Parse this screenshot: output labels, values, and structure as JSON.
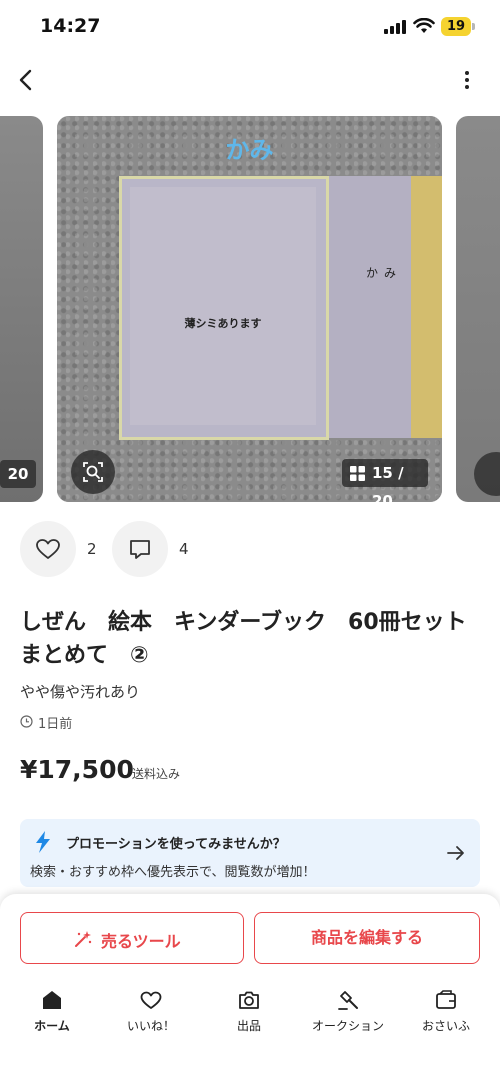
{
  "status_bar": {
    "time": "14:27",
    "battery": "19"
  },
  "carousel": {
    "prev_counter": "20",
    "book_title": "かみ",
    "book_note": "薄シミあります",
    "book_right_label": "かみ",
    "counter": "15 / 20"
  },
  "stats": {
    "likes": "2",
    "comments": "4"
  },
  "item": {
    "title": "しぜん　絵本　キンダーブック　60冊セット　まとめて　②",
    "condition": "やや傷や汚れあり",
    "posted": "1日前",
    "price": "¥17,500",
    "shipping": "送料込み"
  },
  "promo": {
    "title": "プロモーションを使ってみませんか？",
    "description": "検索・おすすめ枠へ優先表示で、閲覧数が増加！"
  },
  "actions": {
    "sell_tools": "売るツール",
    "edit_item": "商品を編集する"
  },
  "tabs": [
    {
      "label": "ホーム",
      "icon": "home-icon"
    },
    {
      "label": "いいね！",
      "icon": "heart-icon"
    },
    {
      "label": "出品",
      "icon": "camera-icon"
    },
    {
      "label": "オークション",
      "icon": "gavel-icon"
    },
    {
      "label": "おさいふ",
      "icon": "wallet-icon"
    }
  ],
  "colors": {
    "accent": "#e8474b",
    "promo_bg": "#eaf3fd",
    "bolt": "#1e88e5",
    "battery": "#f5d330"
  }
}
